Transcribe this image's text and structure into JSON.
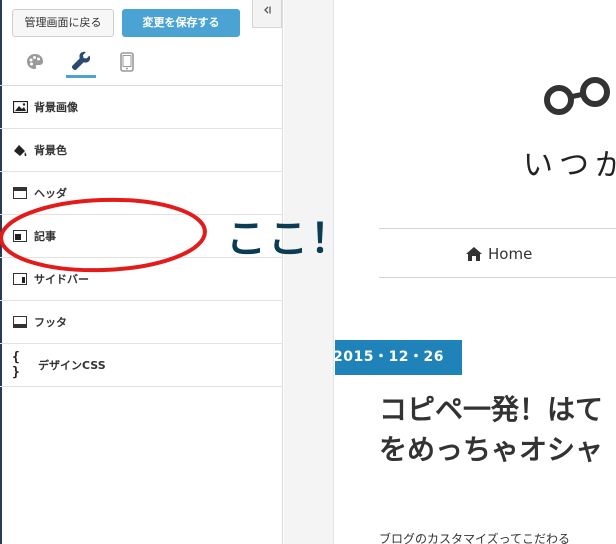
{
  "panel": {
    "back_label": "管理画面に戻る",
    "save_label": "変更を保存する",
    "collapse_icon": "collapse-left-icon",
    "tabs": [
      {
        "name": "palette-icon",
        "active": false
      },
      {
        "name": "wrench-icon",
        "active": true
      },
      {
        "name": "mobile-icon",
        "active": false
      }
    ],
    "menu": [
      {
        "label": "背景画像",
        "icon": "image-icon"
      },
      {
        "label": "背景色",
        "icon": "paint-bucket-icon"
      },
      {
        "label": "ヘッダ",
        "icon": "layout-header-icon"
      },
      {
        "label": "記事",
        "icon": "layout-article-icon"
      },
      {
        "label": "サイドバー",
        "icon": "layout-sidebar-icon"
      },
      {
        "label": "フッタ",
        "icon": "layout-footer-icon"
      },
      {
        "label": "デザインCSS",
        "icon": "braces-icon"
      }
    ],
    "accent_color": "#4aa3d3"
  },
  "annotation": {
    "text": "ここ！",
    "color": "#0c3b54",
    "circle_color": "#e31b1b"
  },
  "preview": {
    "site_title": "いつか",
    "nav_home": "Home",
    "date": "2015・12・26",
    "date_color": "#1f83b9",
    "post_title_line1": "コピペ一発！はて",
    "post_title_line2": "をめっちゃオシャ",
    "excerpt": "ブログのカスタマイズってこだわる"
  }
}
